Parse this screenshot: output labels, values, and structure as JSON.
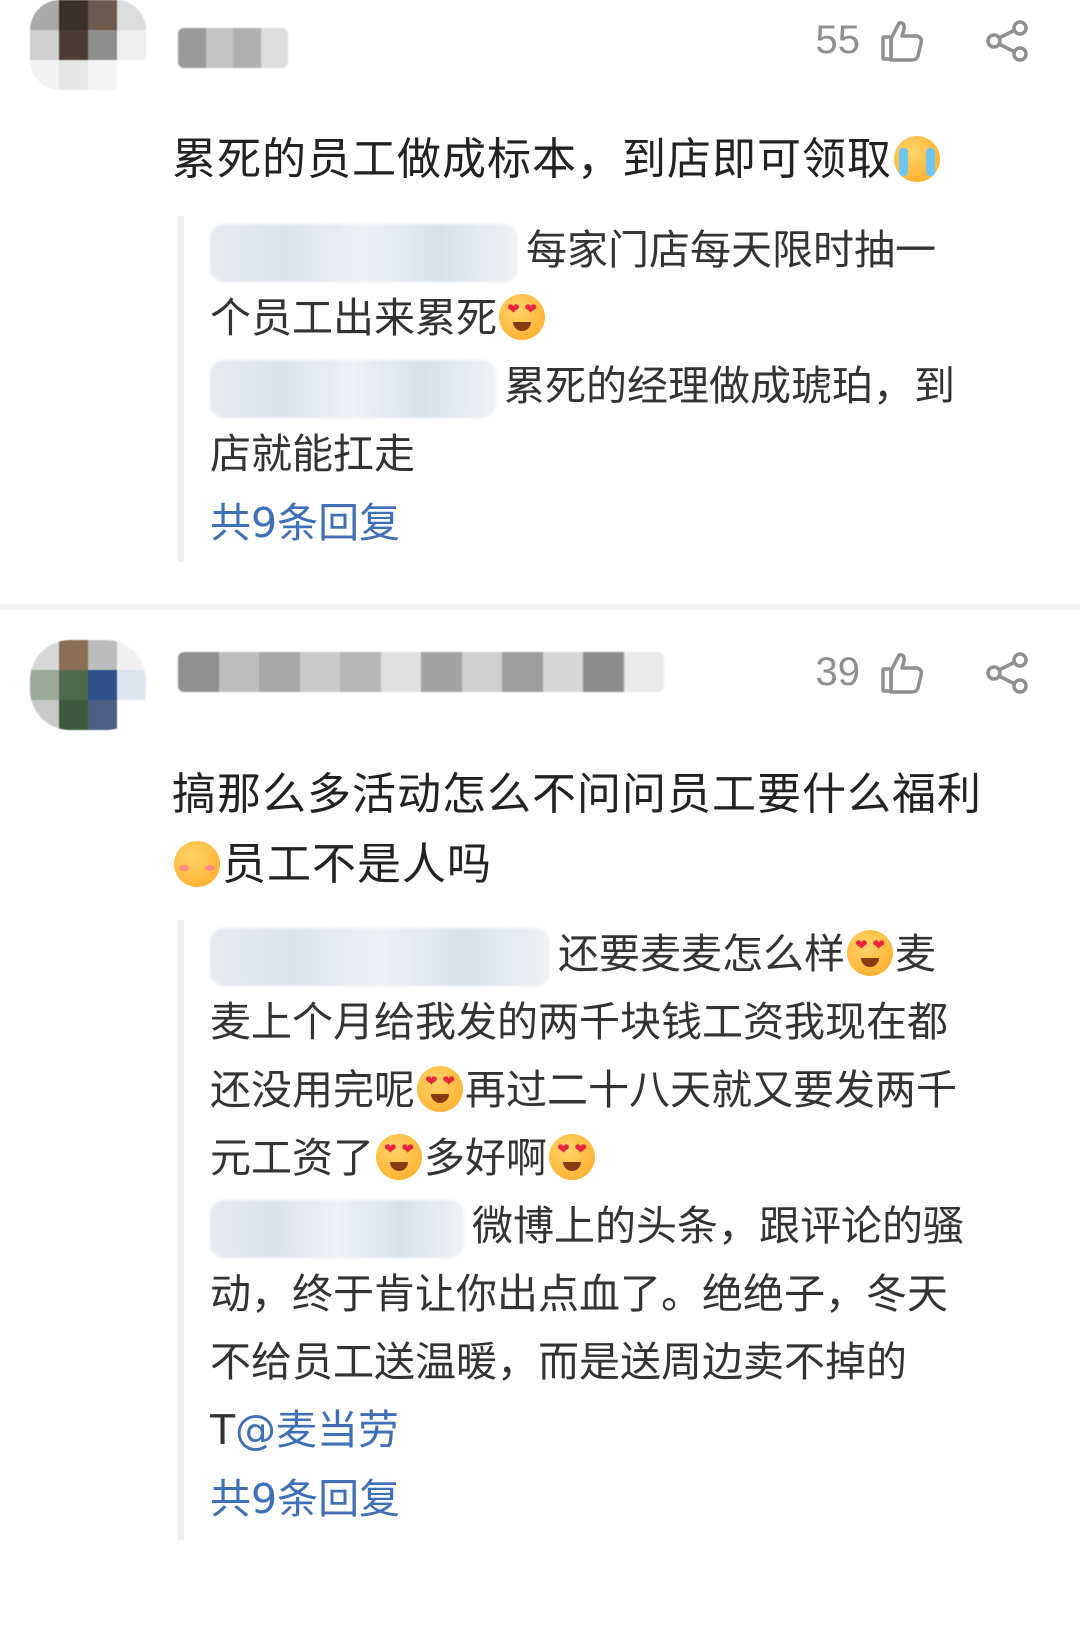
{
  "comments": [
    {
      "likes": "55",
      "text": "累死的员工做成标本，到店即可领取",
      "replies": [
        {
          "text_a": "每家门店每天限时抽一",
          "text_b": "个员工出来累死"
        },
        {
          "text_a": "累死的经理做成琥珀，到",
          "text_b": "店就能扛走"
        }
      ],
      "more": "共9条回复"
    },
    {
      "likes": "39",
      "text_line1": "搞那么多活动怎么不问问员工要什么福利",
      "text_line2": "员工不是人吗",
      "replies": [
        {
          "line1": "还要麦麦怎么样",
          "line1b": "麦",
          "line2": "麦上个月给我发的两千块钱工资我现在都",
          "line3a": "还没用完呢",
          "line3b": "再过二十八天就又要发两千",
          "line4a": "元工资了",
          "line4b": "多好啊"
        },
        {
          "line1": "微博上的头条，跟评论的骚",
          "line2": "动，终于肯让你出点血了。绝绝子，冬天",
          "line3": "不给员工送温暖，而是送周边卖不掉的",
          "line4a": "T",
          "line4b": "@麦当劳"
        }
      ],
      "more": "共9条回复"
    }
  ],
  "icons": {
    "like": "thumbs-up-icon",
    "share": "share-icon",
    "emoji_love": "heart-eyes-emoji-icon",
    "emoji_cry": "crying-emoji-icon",
    "emoji_shy": "blushing-emoji-icon"
  },
  "colors": {
    "link": "#3f6fb6",
    "muted": "#8f8f8f",
    "text": "#222222"
  }
}
